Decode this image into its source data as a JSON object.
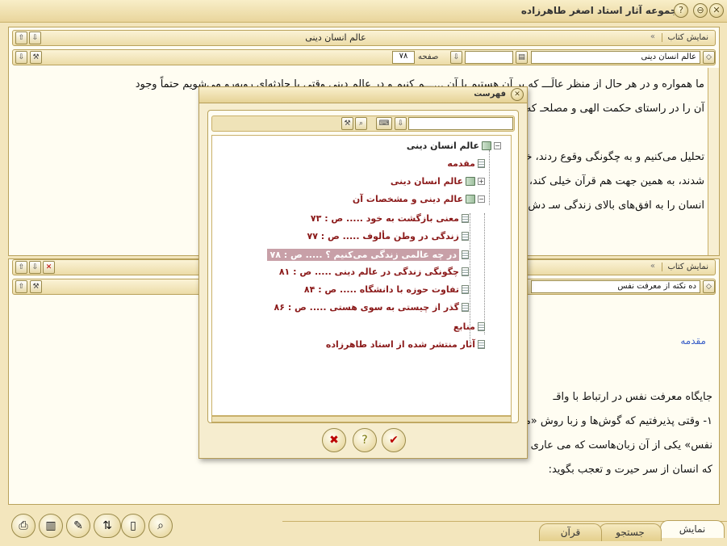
{
  "window": {
    "title": "مجموعه آثار استاد اصغر طاهرزاده"
  },
  "top_panel": {
    "show_book_label": "نمایش کتاب",
    "title": "عالم انسان دینی",
    "book_select": "عالم انسان دینی",
    "page_label": "صفحه",
    "page_value": "۷۸",
    "paragraphs": [
      "ما همواره و در هر حال از منظر عالَـــ که بر آن هستیم با آن ...ـــم کنیم و در عالم دینی وقتی با حادثه‌ای روبه‌رو می‌شویم حتماً وجود",
      "آن را در راستای حکمت الهی و مصلحـ                                                                  که خدای عالم دنبال می‌کند",
      "",
      "تحلیل می‌کنیم و به چگونگی وقوع                                                          ردند، خیلی مهم نیست که چگونه هلاک",
      "شدند، به همین جهت هم قرآن خیلی                                                       کند، نه علت فاعلی را. زیرا غایت‌نگری،",
      "انسان را به افق‌های بالای زندگی سـ                                                       دش می‌کند. در عالَم دینی وقتی هم در"
    ]
  },
  "bottom_panel": {
    "show_book_label": "نمایش کتاب",
    "book_select": "ده نکته از معرفت نفس",
    "heading": "مقدمه",
    "paragraphs": [
      "جایگاه معرفت نفس در ارتباط با واقـ",
      "۱- وقتی پذیرفتیم که گوش‌ها و زبا                                                      روش «معرفت هستی از طریق معرفت",
      "نفس» یکی از آن زبان‌هاست که می                                                      عاری از بدن و زمان و مکان، تا جایی",
      "که انسان از سر حیرت و تعجب بگوید:"
    ]
  },
  "dialog": {
    "title": "فهرست",
    "items": [
      {
        "label": "عالم انسان دینی",
        "type": "book",
        "expander": "−",
        "color": "#222"
      },
      {
        "label": "مقدمه",
        "type": "page",
        "color": "#8b1a1a"
      },
      {
        "label": "عالم انسان دینی",
        "type": "book-closed",
        "expander": "+",
        "color": "#8b1a1a"
      },
      {
        "label": "عالم دینی و مشخصات آن",
        "type": "book",
        "expander": "−",
        "color": "#8b1a1a"
      },
      {
        "label": "معنی بازگشت به خود ..... ص : ۷۳",
        "type": "page",
        "color": "#8b1a1a"
      },
      {
        "label": "زندگی در وطن مألوف ..... ص : ۷۷",
        "type": "page",
        "color": "#8b1a1a"
      },
      {
        "label": "در چه عالمی زندگی می‌کنیم ؟ ..... ص : ۷۸",
        "type": "page",
        "color": "#ffffff",
        "selected": true
      },
      {
        "label": "چگونگی زندگی در عالم دینی ..... ص : ۸۱",
        "type": "page",
        "color": "#8b1a1a"
      },
      {
        "label": "تفاوت حوزه با دانشگاه ..... ص : ۸۴",
        "type": "page",
        "color": "#8b1a1a"
      },
      {
        "label": "گذر از چیستی به سوی هستی ..... ص : ۸۶",
        "type": "page",
        "color": "#8b1a1a"
      },
      {
        "label": "منابع",
        "type": "page",
        "color": "#8b1a1a"
      },
      {
        "label": "آثار منتشر شده از استاد طاهرزاده",
        "type": "page",
        "color": "#8b1a1a"
      }
    ]
  },
  "tabs": [
    "نمایش",
    "جستجو",
    "قرآن"
  ],
  "colors": {
    "accent": "#8b1a1a",
    "selected_bg": "#c8a0a8",
    "panel": "#f3e6bd"
  }
}
